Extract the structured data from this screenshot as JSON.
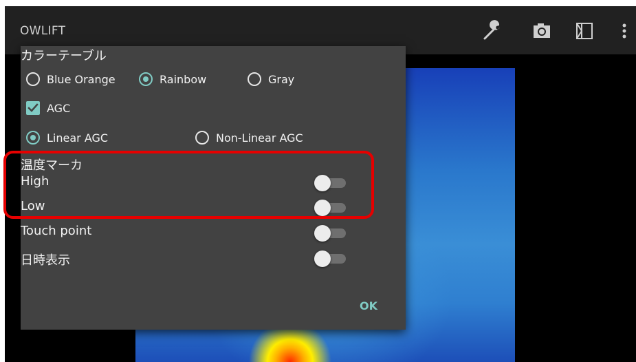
{
  "app": {
    "title": "OWLIFT"
  },
  "toolbar": {
    "icons": [
      "wrench-icon",
      "camera-icon",
      "panel-icon",
      "overflow-menu-icon"
    ],
    "icon_color": "#cfcfcf"
  },
  "dialog": {
    "color_table": {
      "header": "カラーテーブル",
      "options": [
        {
          "label": "Blue Orange",
          "checked": false
        },
        {
          "label": "Rainbow",
          "checked": true
        },
        {
          "label": "Gray",
          "checked": false
        }
      ]
    },
    "agc": {
      "label": "AGC",
      "checked": true
    },
    "agc_mode": {
      "options": [
        {
          "label": "Linear AGC",
          "checked": true
        },
        {
          "label": "Non-Linear AGC",
          "checked": false
        }
      ]
    },
    "temp_marker": {
      "header": "温度マーカ",
      "high": {
        "label": "High",
        "on": false
      },
      "low": {
        "label": "Low",
        "on": false
      }
    },
    "touch_point": {
      "label": "Touch point",
      "on": false
    },
    "datetime": {
      "label": "日時表示",
      "on": false
    },
    "ok_label": "OK"
  },
  "colors": {
    "accent": "#80cbc4",
    "dialog_bg": "#424242",
    "highlight": "#e60000"
  }
}
